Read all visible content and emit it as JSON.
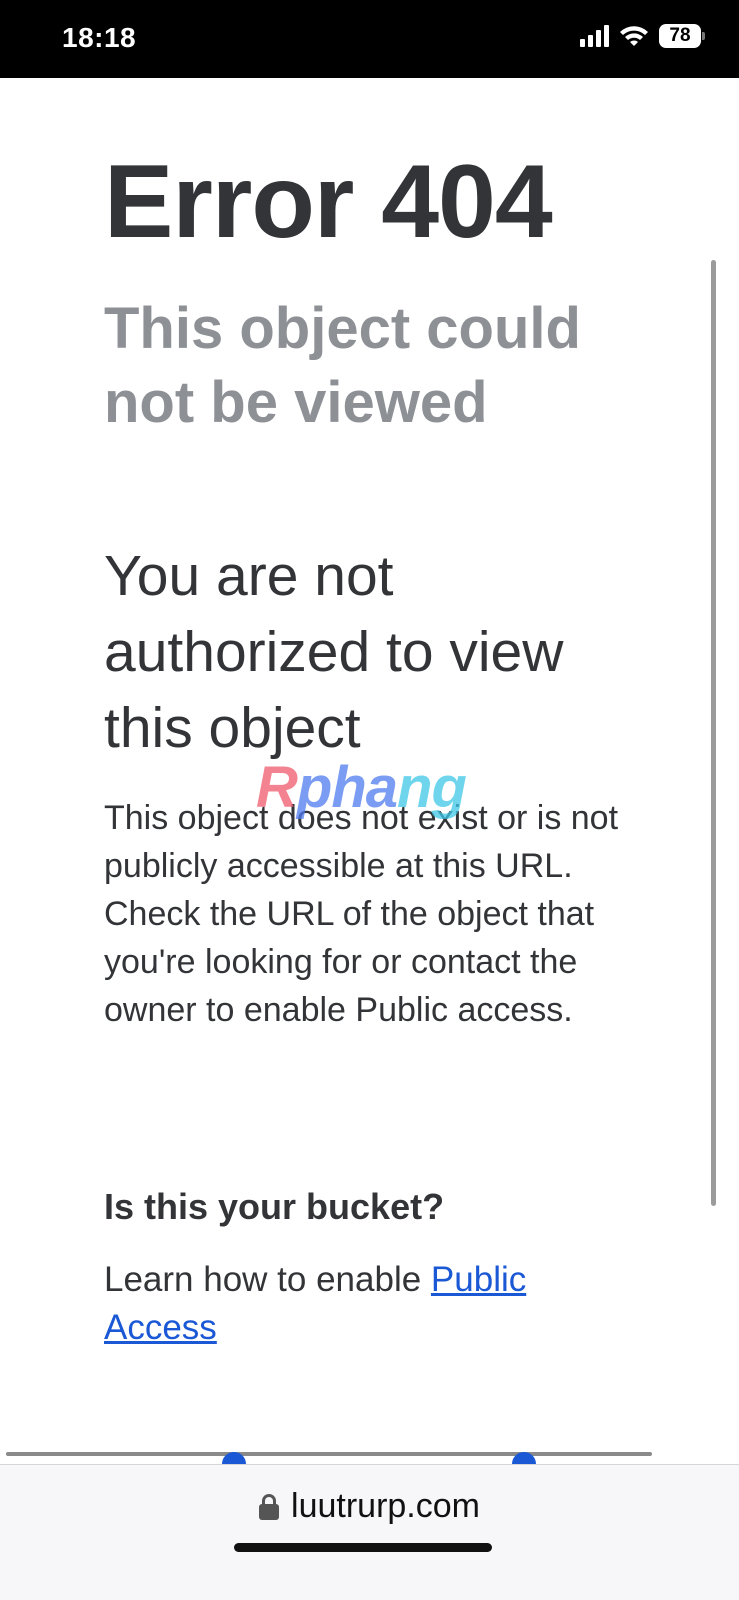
{
  "status_bar": {
    "time": "18:18",
    "battery": "78",
    "icons": [
      "signal-icon",
      "wifi-icon",
      "battery-icon"
    ]
  },
  "page": {
    "title": "Error 404",
    "subtitle": "This object could not be viewed",
    "heading": "You are not authorized to view this object",
    "body": "This object does not exist or is not publicly accessible at this URL. Check the URL of the object that you're looking for or contact the owner to enable Public access.",
    "bucket_heading": "Is this your bucket?",
    "learn_text": "Learn how to enable ",
    "learn_link": "Public Access"
  },
  "watermark": {
    "part1": "R",
    "part2": "pha",
    "part3": "ng"
  },
  "browser": {
    "url": "luutrurp.com",
    "lock_icon": "lock-icon"
  },
  "colors": {
    "title": "#323437",
    "subtitle": "#8d9095",
    "link": "#1a58d6"
  }
}
